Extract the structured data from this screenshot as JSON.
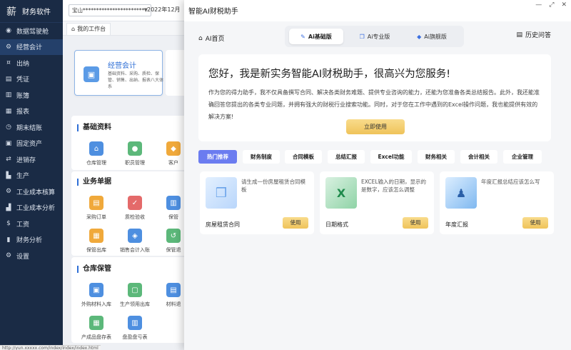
{
  "app": {
    "logo_glyph": "薪",
    "title": "财务软件"
  },
  "sidebar": {
    "items": [
      {
        "label": "数据驾驶舱",
        "icon": "dashboard-icon"
      },
      {
        "label": "经营会计",
        "icon": "gear-icon"
      },
      {
        "label": "出纳",
        "icon": "money-icon"
      },
      {
        "label": "凭证",
        "icon": "voucher-icon"
      },
      {
        "label": "账簿",
        "icon": "book-icon"
      },
      {
        "label": "报表",
        "icon": "report-icon"
      },
      {
        "label": "期末结账",
        "icon": "close-period-icon"
      },
      {
        "label": "固定资产",
        "icon": "asset-icon"
      },
      {
        "label": "进销存",
        "icon": "inventory-icon"
      },
      {
        "label": "生产",
        "icon": "production-icon"
      },
      {
        "label": "工业成本核算",
        "icon": "cost-icon"
      },
      {
        "label": "工业成本分析",
        "icon": "analysis-icon"
      },
      {
        "label": "工资",
        "icon": "salary-icon"
      },
      {
        "label": "财务分析",
        "icon": "chart-icon"
      },
      {
        "label": "设置",
        "icon": "settings-icon"
      }
    ]
  },
  "topbar": {
    "company": "宝山***********************",
    "period": "2022年12月"
  },
  "tabbar": {
    "home_tab": "我的工作台"
  },
  "workspace": {
    "main_card": {
      "title": "经营会计",
      "desc": "基础资料、采购、质检、保管、销售、出纳、报表八大体系"
    },
    "sections": [
      {
        "title": "基础资料",
        "tiles": [
          "仓库管理",
          "职员管理",
          "客户"
        ]
      },
      {
        "title": "业务单据",
        "tiles": [
          "采购订单",
          "质检验收",
          "保管",
          "保管出库",
          "销售会计入账",
          "保管退"
        ]
      },
      {
        "title": "仓库保管",
        "tiles": [
          "外购材料入库",
          "生产领用出库",
          "材料退",
          "产成品盘存表",
          "盘盈盘亏表"
        ]
      }
    ]
  },
  "status_url": "http://yun.xxxxx.com/index/index/index.html",
  "ai": {
    "window_title": "智能AI财税助手",
    "window_controls": {
      "minimize": "—",
      "maximize": "⤢",
      "close": "✕"
    },
    "home_link": "AI首页",
    "versions": [
      {
        "label": "Ai基础版",
        "active": true,
        "icon": "pen-icon"
      },
      {
        "label": "Ai专业版",
        "active": false,
        "icon": "cube-icon"
      },
      {
        "label": "Ai旗舰版",
        "active": false,
        "icon": "diamond-icon"
      }
    ],
    "history": "历史问答",
    "hero": {
      "title": "您好，我是新实务智能AI财税助手，很高兴为您服务!",
      "desc": "作为您的得力助手，我不仅具备撰写合同、解决各类财务难题、提供专业咨询的能力，还能为您准备各类总结报告。此外，我还能准确回答您提出的各类专业问题，并拥有强大的财税行业搜索功能。同时，对于您在工作中遇到的Excel操作问题，我也能提供有效的解决方案!",
      "button": "立即使用"
    },
    "categories": [
      "热门推荐",
      "财务制度",
      "合同模板",
      "总结汇报",
      "Excel功能",
      "财务相关",
      "会计相关",
      "企业管理"
    ],
    "active_category": "热门推荐",
    "templates": [
      {
        "text": "请生成一份房屋租赁合同模板",
        "name": "房屋租赁合同",
        "button": "使用",
        "icon": "document-stack-icon"
      },
      {
        "text": "EXCEL输入的日期，显示的是数字，应该怎么调整",
        "name": "日期格式",
        "button": "使用",
        "icon": "excel-icon"
      },
      {
        "text": "年度汇报总结应该怎么写",
        "name": "年度汇报",
        "button": "使用",
        "icon": "presenter-icon"
      }
    ],
    "colors": {
      "accent": "#6b7cf0",
      "gold": "#efc35a",
      "sidebar": "#1a2b45"
    }
  }
}
